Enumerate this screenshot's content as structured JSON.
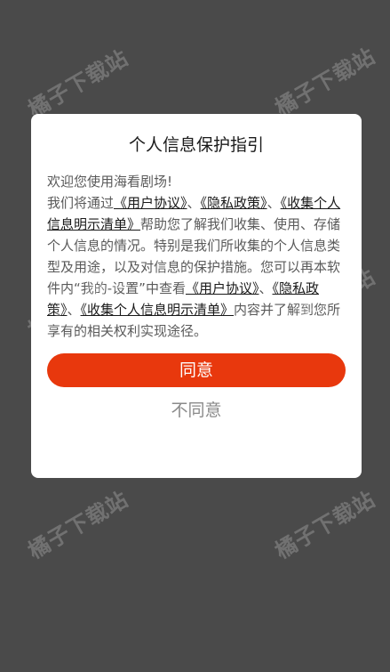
{
  "watermark": {
    "text": "橘子下载站"
  },
  "dialog": {
    "title": "个人信息保护指引",
    "greeting": "欢迎您使用海看剧场!",
    "p_intro": "我们将通过",
    "link_user_agreement": "《用户协议》",
    "sep1": "、",
    "link_privacy_policy": "《隐私政策》",
    "sep2": "、",
    "link_collection_list": "《收集个人信息明示清单》",
    "p_middle": "帮助您了解我们收集、使用、存储个人信息的情况。特别是我们所收集的个人信息类型及用途，以及对信息的保护措施。您可以再本软件内“我的-设置”中查看",
    "link_user_agreement_2": "《用户协议》",
    "sep3": "、",
    "link_privacy_policy_2": "《隐私政策》",
    "sep4": "、",
    "link_collection_list_2": "《收集个人信息明示清单》",
    "p_end": "内容并了解到您所享有的相关权利实现途径。",
    "agree_label": "同意",
    "disagree_label": "不同意"
  },
  "colors": {
    "background": "#4a4a4a",
    "accent": "#e8380d"
  }
}
